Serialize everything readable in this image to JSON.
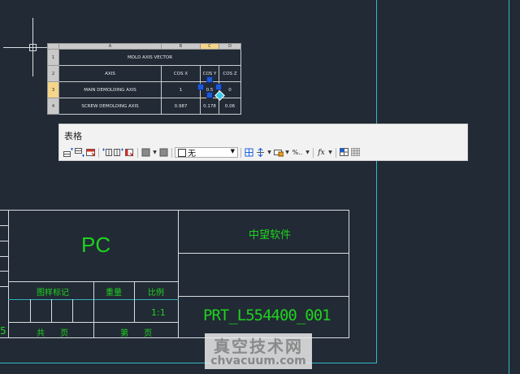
{
  "sheet": {
    "col_headers": [
      "A",
      "B",
      "C",
      "D"
    ],
    "rows": [
      {
        "num": "1",
        "a": "MOLD AXIS VECTOR",
        "b": "",
        "c": "",
        "d": ""
      },
      {
        "num": "2",
        "a": "AXIS",
        "b": "COS X",
        "c": "COS Y",
        "d": "COS Z"
      },
      {
        "num": "3",
        "a": "MAIN DEMOLDING AXIS",
        "b": "1",
        "c": "0.5",
        "d": "0"
      },
      {
        "num": "4",
        "a": "SCREW DEMOLDING AXIS",
        "b": "0.987",
        "c": "0.178",
        "d": "0.06"
      }
    ]
  },
  "toolbar": {
    "title": "表格",
    "dropdown_value": "无",
    "percent_label": "%..",
    "fx_label": "fx"
  },
  "title_block": {
    "material": "PC",
    "company": "中望软件",
    "drawing_number": "PRT_L554400_001",
    "label_mark": "图样标记",
    "label_weight": "重量",
    "label_scale": "比例",
    "scale_value": "1:1",
    "label_total": "共 页",
    "label_sheet": "第 页",
    "left_number": "5"
  },
  "watermark": {
    "title": "真空技术网",
    "url": "chvacuum.com"
  },
  "colors": {
    "background": "#222a35",
    "border_cyan": "#35b9c4",
    "text_green": "#1fd21f"
  }
}
